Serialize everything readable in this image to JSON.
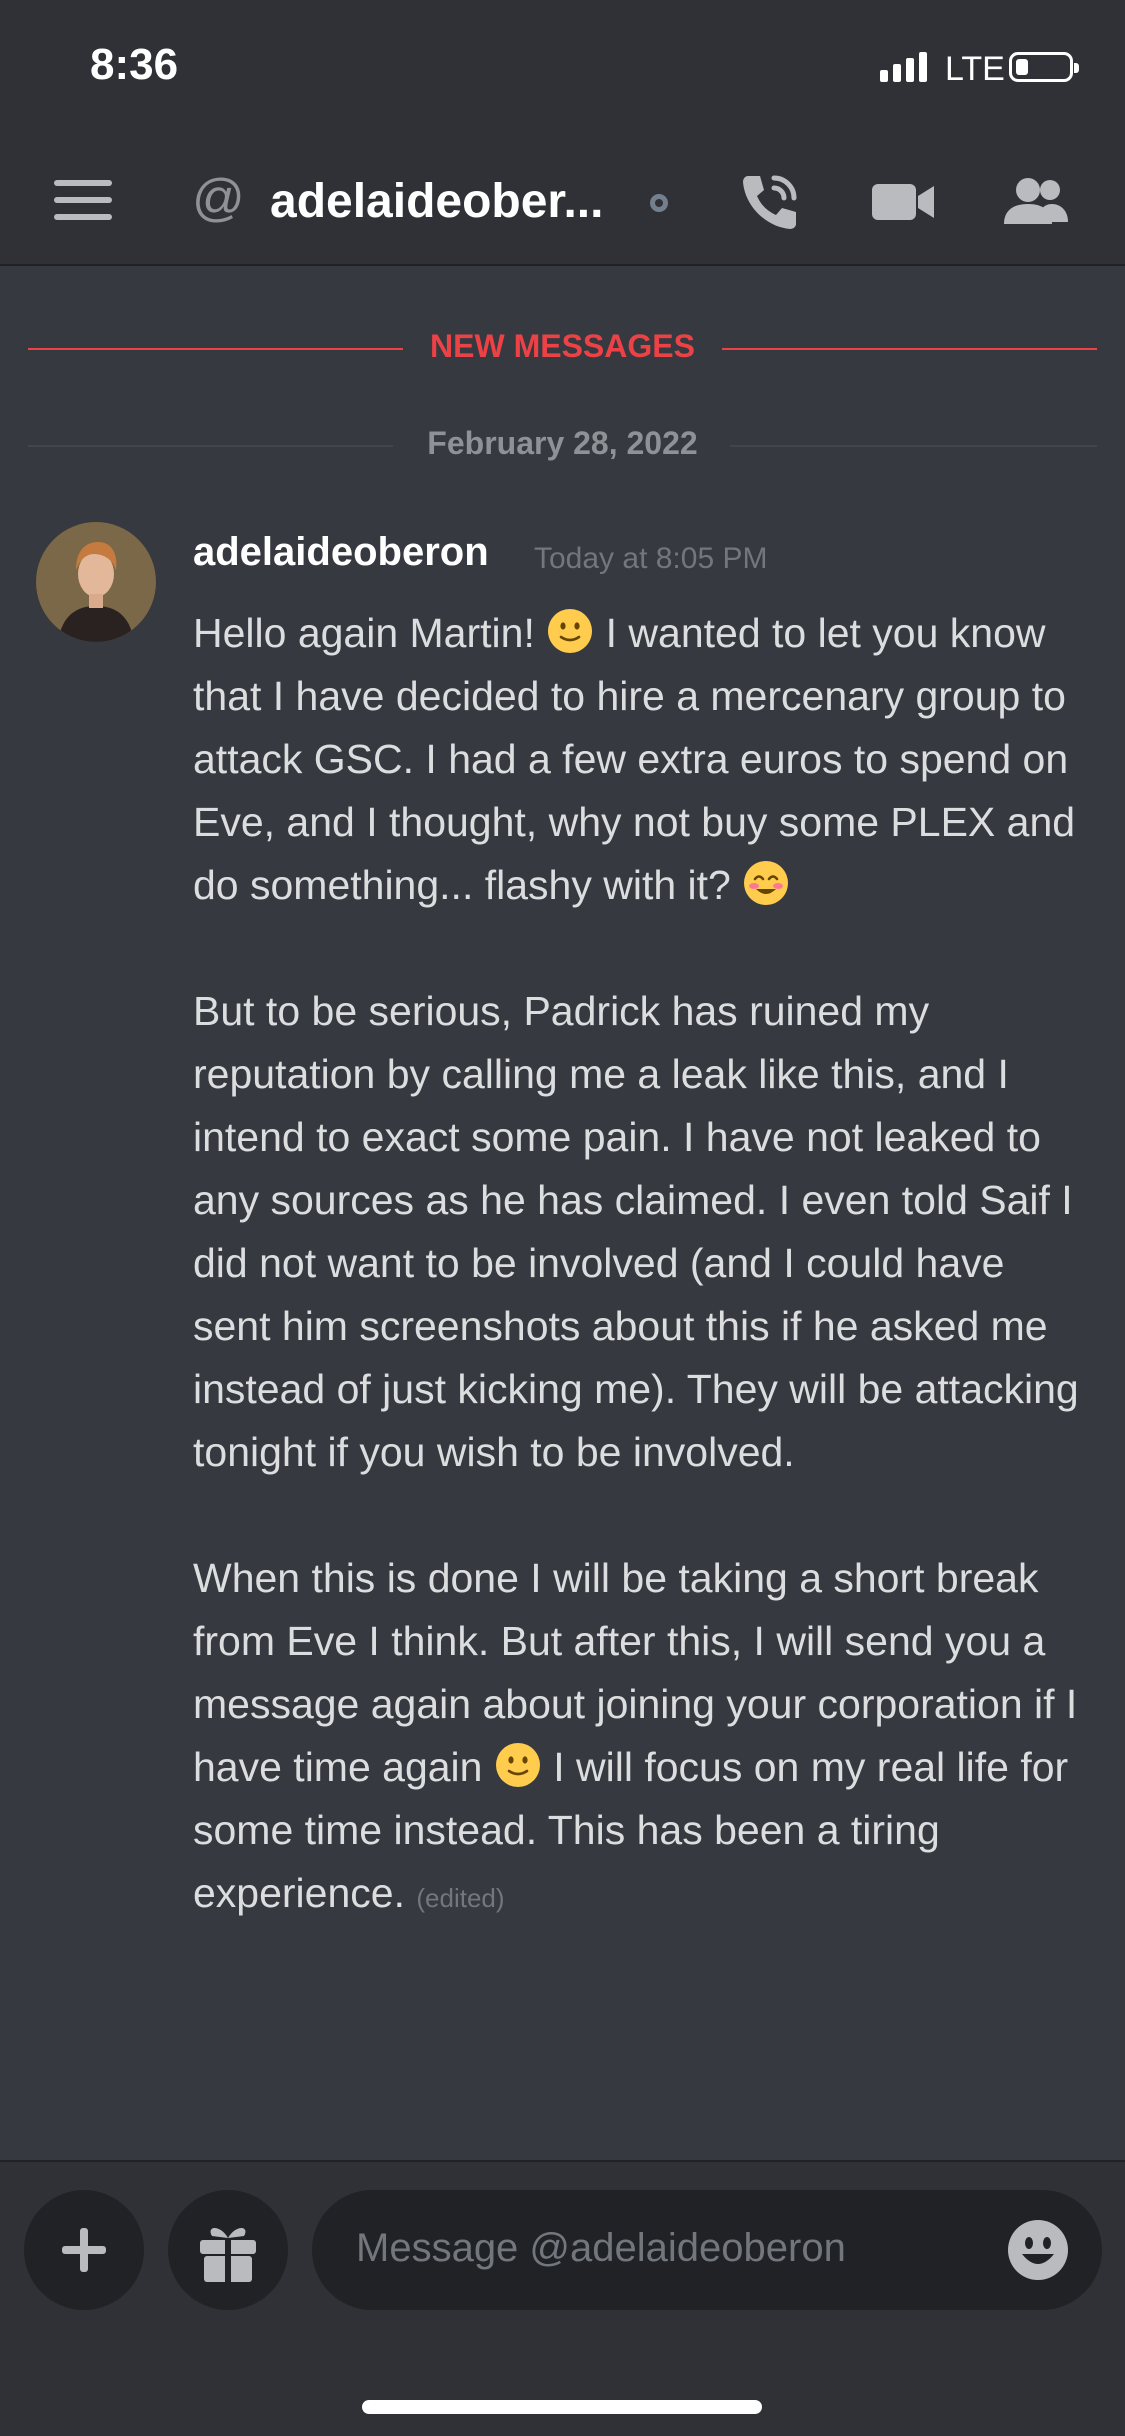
{
  "status_bar": {
    "time": "8:36",
    "network": "LTE"
  },
  "header": {
    "channel": "adelaideober...",
    "at_symbol": "@"
  },
  "divider_new": {
    "label": "NEW MESSAGES",
    "color": "#ed4245"
  },
  "divider_date": {
    "label": "February 28, 2022"
  },
  "message": {
    "author": "adelaideoberon",
    "timestamp": "Today at 8:05 PM",
    "p1_a": "Hello again Martin! ",
    "p1_b": " I wanted to let you know that I have decided to hire a mercenary group to attack GSC. I had a few extra euros to spend on Eve, and I thought, why not buy some PLEX and do something... flashy with it? ",
    "p2": "But to be serious, Padrick has ruined my reputation by calling me a leak like this, and I intend to exact some pain. I have not leaked to any sources as he has claimed. I even told Saif I did not want to be involved (and I could have sent him screenshots about this if he asked me instead of just kicking me). They will be attacking tonight if you wish to be involved.",
    "p3_a": "When this is done I will be taking a short break from Eve I think. But after this, I will send you a message again about joining your corporation if I have time again ",
    "p3_b": " I will focus on my real life for some time instead. This has been a tiring experience. ",
    "edited": "(edited)"
  },
  "composer": {
    "placeholder": "Message @adelaideoberon"
  },
  "icons": [
    "menu-icon",
    "call-icon",
    "video-icon",
    "members-icon",
    "plus-icon",
    "gift-icon",
    "emoji-icon",
    "slight-smile-emoji",
    "blush-emoji"
  ]
}
